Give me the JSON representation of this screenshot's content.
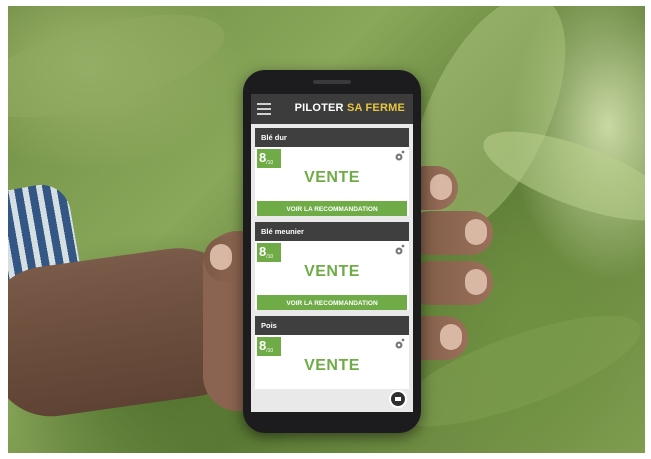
{
  "header": {
    "brand_main": "PILOTER",
    "brand_accent": "SA FERME"
  },
  "cards": [
    {
      "crop": "Blé dur",
      "score": "8",
      "score_max": "/10",
      "recommendation": "VENTE",
      "button_label": "VOIR LA RECOMMANDATION"
    },
    {
      "crop": "Blé meunier",
      "score": "8",
      "score_max": "/10",
      "recommendation": "VENTE",
      "button_label": "VOIR LA RECOMMANDATION"
    },
    {
      "crop": "Pois",
      "score": "8",
      "score_max": "/10",
      "recommendation": "VENTE"
    }
  ],
  "colors": {
    "accent_green": "#6fab47",
    "brand_yellow": "#e6c640",
    "header_dark": "#3c3c3c"
  },
  "icons": {
    "menu": "hamburger-menu-icon",
    "card_corner": "gear-icon",
    "fab": "message-icon"
  }
}
